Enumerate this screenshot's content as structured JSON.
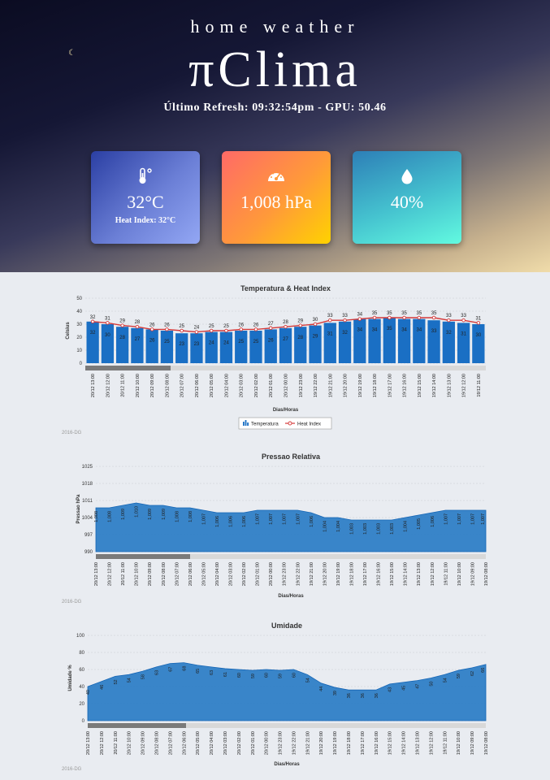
{
  "header": {
    "subtitle": "home weather",
    "title": "πClima",
    "refresh_label": "Último Refresh: 09:32:54pm - GPU: 50.46"
  },
  "cards": [
    {
      "icon": "thermometer-icon",
      "value": "32°C",
      "sub": "Heat Index: 32°C"
    },
    {
      "icon": "gauge-icon",
      "value": "1,008 hPa",
      "sub": ""
    },
    {
      "icon": "droplet-icon",
      "value": "40%",
      "sub": ""
    }
  ],
  "credit": "2016-DG",
  "chart_data": [
    {
      "type": "bar",
      "title": "Temperatura & Heat Index",
      "xlabel": "Dias/Horas",
      "ylabel": "Celsius",
      "ylim": [
        0,
        50
      ],
      "yticks": [
        0,
        10,
        20,
        30,
        40,
        50
      ],
      "categories": [
        "20/12 13:00",
        "20/12 12:00",
        "20/12 11:00",
        "20/12 10:00",
        "20/12 09:00",
        "20/12 08:00",
        "20/12 07:00",
        "20/12 06:00",
        "20/12 05:00",
        "20/12 04:00",
        "20/12 03:00",
        "20/12 02:00",
        "20/12 01:00",
        "20/12 00:00",
        "19/12 23:00",
        "19/12 22:00",
        "19/12 21:00",
        "19/12 20:00",
        "19/12 19:00",
        "19/12 18:00",
        "19/12 17:00",
        "19/12 16:00",
        "19/12 15:00",
        "19/12 14:00",
        "19/12 13:00",
        "19/12 12:00",
        "19/12 11:00"
      ],
      "series": [
        {
          "name": "Temperatura",
          "type": "bar",
          "values": [
            32,
            30,
            28,
            27,
            26,
            25,
            23,
            23,
            24,
            24,
            25,
            25,
            26,
            27,
            28,
            29,
            31,
            32,
            34,
            34,
            35,
            34,
            34,
            33,
            32,
            31,
            30
          ]
        },
        {
          "name": "Heat Index",
          "type": "line",
          "values": [
            32,
            31,
            29,
            28,
            26,
            26,
            25,
            24,
            25,
            25,
            26,
            26,
            27,
            28,
            29,
            30,
            33,
            33,
            34,
            35,
            35,
            35,
            35,
            35,
            33,
            33,
            31
          ]
        }
      ],
      "legend": "bottom-center",
      "colors": {
        "bar": "#1a6fc4",
        "line": "#d43a3a"
      }
    },
    {
      "type": "area",
      "title": "Pressao Relativa",
      "xlabel": "Dias/Horas",
      "ylabel": "Pressao hPa",
      "ylim": [
        990,
        1025
      ],
      "yticks": [
        990,
        997,
        1004,
        1011,
        1018,
        1025
      ],
      "categories": [
        "20/12 13:00",
        "20/12 12:00",
        "20/12 11:00",
        "20/12 10:00",
        "20/12 09:00",
        "20/12 08:00",
        "20/12 07:00",
        "20/12 06:00",
        "20/12 05:00",
        "20/12 04:00",
        "20/12 03:00",
        "20/12 02:00",
        "20/12 01:00",
        "20/12 00:00",
        "19/12 23:00",
        "19/12 22:00",
        "19/12 21:00",
        "19/12 20:00",
        "19/12 19:00",
        "19/12 18:00",
        "19/12 17:00",
        "19/12 16:00",
        "19/12 15:00",
        "19/12 14:00",
        "19/12 13:00",
        "19/12 12:00",
        "19/12 11:00",
        "19/12 10:00",
        "19/12 09:00",
        "19/12 08:00"
      ],
      "values": [
        1008,
        1008,
        1009,
        1010,
        1009,
        1009,
        1008,
        1008,
        1007,
        1006,
        1006,
        1006,
        1007,
        1007,
        1007,
        1007,
        1006,
        1004,
        1004,
        1003,
        1003,
        1003,
        1003,
        1004,
        1005,
        1006,
        1007,
        1007,
        1007,
        1007
      ],
      "colors": {
        "area": "#1a73c2"
      }
    },
    {
      "type": "area",
      "title": "Umidade",
      "xlabel": "Dias/Horas",
      "ylabel": "Umidade %",
      "ylim": [
        0,
        100
      ],
      "yticks": [
        0,
        20,
        40,
        60,
        80,
        100
      ],
      "categories": [
        "20/12 13:00",
        "20/12 12:00",
        "20/12 11:00",
        "20/12 10:00",
        "20/12 09:00",
        "20/12 08:00",
        "20/12 07:00",
        "20/12 06:00",
        "20/12 05:00",
        "20/12 04:00",
        "20/12 03:00",
        "20/12 02:00",
        "20/12 01:00",
        "20/12 00:00",
        "19/12 23:00",
        "19/12 22:00",
        "19/12 21:00",
        "19/12 20:00",
        "19/12 19:00",
        "19/12 18:00",
        "19/12 17:00",
        "19/12 16:00",
        "19/12 15:00",
        "19/12 14:00",
        "19/12 13:00",
        "19/12 12:00",
        "19/12 11:00",
        "19/12 10:00",
        "19/12 09:00",
        "19/12 08:00"
      ],
      "values": [
        40,
        46,
        52,
        54,
        58,
        63,
        67,
        68,
        65,
        63,
        61,
        60,
        59,
        60,
        59,
        60,
        54,
        44,
        39,
        36,
        36,
        36,
        43,
        45,
        47,
        50,
        54,
        59,
        62,
        66
      ],
      "colors": {
        "area": "#1a73c2"
      }
    }
  ]
}
